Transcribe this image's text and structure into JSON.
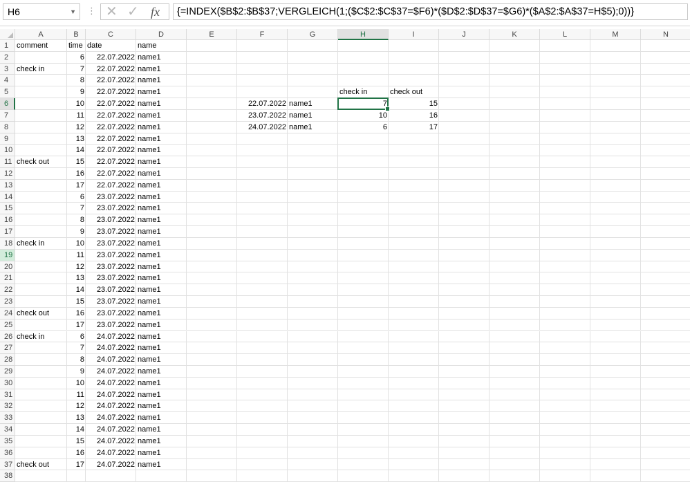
{
  "formula_bar": {
    "name_box": "H6",
    "cancel_glyph": "✕",
    "enter_glyph": "✓",
    "fx_label": "fx",
    "formula": "{=INDEX($B$2:$B$37;VERGLEICH(1;($C$2:$C$37=$F6)*($D$2:$D$37=$G6)*($A$2:$A$37=H$5);0))}"
  },
  "columns": [
    "A",
    "B",
    "C",
    "D",
    "E",
    "F",
    "G",
    "H",
    "I",
    "J",
    "K",
    "L",
    "M",
    "N"
  ],
  "selected_column": "H",
  "selected_row": 6,
  "highlighted_row": 19,
  "row_count": 38,
  "data_table": {
    "headers": [
      "comment",
      "time",
      "date",
      "name"
    ],
    "rows": [
      [
        "",
        "6",
        "22.07.2022",
        "name1"
      ],
      [
        "check in",
        "7",
        "22.07.2022",
        "name1"
      ],
      [
        "",
        "8",
        "22.07.2022",
        "name1"
      ],
      [
        "",
        "9",
        "22.07.2022",
        "name1"
      ],
      [
        "",
        "10",
        "22.07.2022",
        "name1"
      ],
      [
        "",
        "11",
        "22.07.2022",
        "name1"
      ],
      [
        "",
        "12",
        "22.07.2022",
        "name1"
      ],
      [
        "",
        "13",
        "22.07.2022",
        "name1"
      ],
      [
        "",
        "14",
        "22.07.2022",
        "name1"
      ],
      [
        "check out",
        "15",
        "22.07.2022",
        "name1"
      ],
      [
        "",
        "16",
        "22.07.2022",
        "name1"
      ],
      [
        "",
        "17",
        "22.07.2022",
        "name1"
      ],
      [
        "",
        "6",
        "23.07.2022",
        "name1"
      ],
      [
        "",
        "7",
        "23.07.2022",
        "name1"
      ],
      [
        "",
        "8",
        "23.07.2022",
        "name1"
      ],
      [
        "",
        "9",
        "23.07.2022",
        "name1"
      ],
      [
        "check in",
        "10",
        "23.07.2022",
        "name1"
      ],
      [
        "",
        "11",
        "23.07.2022",
        "name1"
      ],
      [
        "",
        "12",
        "23.07.2022",
        "name1"
      ],
      [
        "",
        "13",
        "23.07.2022",
        "name1"
      ],
      [
        "",
        "14",
        "23.07.2022",
        "name1"
      ],
      [
        "",
        "15",
        "23.07.2022",
        "name1"
      ],
      [
        "check out",
        "16",
        "23.07.2022",
        "name1"
      ],
      [
        "",
        "17",
        "23.07.2022",
        "name1"
      ],
      [
        "check in",
        "6",
        "24.07.2022",
        "name1"
      ],
      [
        "",
        "7",
        "24.07.2022",
        "name1"
      ],
      [
        "",
        "8",
        "24.07.2022",
        "name1"
      ],
      [
        "",
        "9",
        "24.07.2022",
        "name1"
      ],
      [
        "",
        "10",
        "24.07.2022",
        "name1"
      ],
      [
        "",
        "11",
        "24.07.2022",
        "name1"
      ],
      [
        "",
        "12",
        "24.07.2022",
        "name1"
      ],
      [
        "",
        "13",
        "24.07.2022",
        "name1"
      ],
      [
        "",
        "14",
        "24.07.2022",
        "name1"
      ],
      [
        "",
        "15",
        "24.07.2022",
        "name1"
      ],
      [
        "",
        "16",
        "24.07.2022",
        "name1"
      ],
      [
        "check out",
        "17",
        "24.07.2022",
        "name1"
      ]
    ]
  },
  "summary": {
    "headers": [
      "check in",
      "check out"
    ],
    "rows": [
      [
        "22.07.2022",
        "name1",
        "7",
        "15"
      ],
      [
        "23.07.2022",
        "name1",
        "10",
        "16"
      ],
      [
        "24.07.2022",
        "name1",
        "6",
        "17"
      ]
    ]
  },
  "colors": {
    "accent": "#217346",
    "grid_line": "#e1e1e1",
    "header_bg": "#f7f7f7"
  }
}
